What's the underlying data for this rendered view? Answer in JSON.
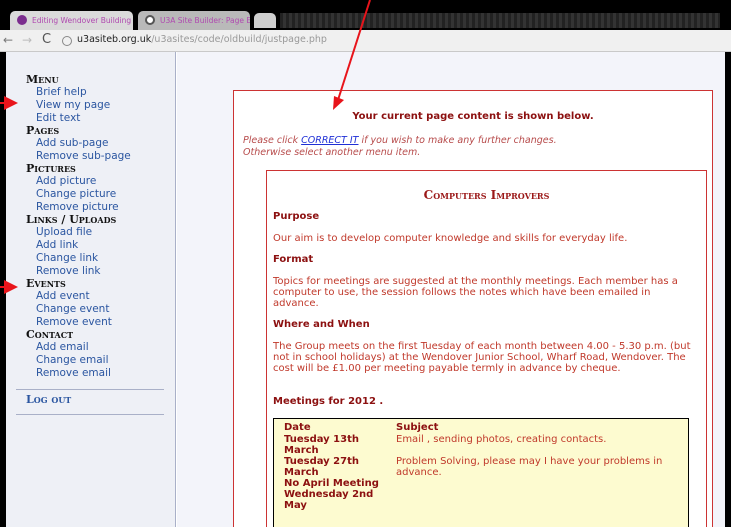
{
  "browser": {
    "tabs": [
      {
        "label": "Editing Wendover Building"
      },
      {
        "label": "U3A Site Builder: Page Edit"
      }
    ],
    "url_host": "u3asiteb.org.uk",
    "url_path": "/u3asites/code/oldbuild/justpage.php"
  },
  "sidebar": {
    "sections": [
      {
        "heading": "Menu",
        "items": [
          "Brief help",
          "View my page",
          "Edit text"
        ]
      },
      {
        "heading": "Pages",
        "items": [
          "Add sub-page",
          "Remove sub-page"
        ]
      },
      {
        "heading": "Pictures",
        "items": [
          "Add picture",
          "Change picture",
          "Remove picture"
        ]
      },
      {
        "heading": "Links / Uploads",
        "items": [
          "Upload file",
          "Add link",
          "Change link",
          "Remove link"
        ]
      },
      {
        "heading": "Events",
        "items": [
          "Add event",
          "Change event",
          "Remove event"
        ]
      },
      {
        "heading": "Contact",
        "items": [
          "Add email",
          "Change email",
          "Remove email"
        ]
      }
    ],
    "logout": "Log out"
  },
  "content": {
    "current_msg": "Your current page content is shown below.",
    "click_prefix": "Please click ",
    "correct_link": "CORRECT IT",
    "click_suffix": " if you wish to make any further changes.",
    "otherwise": "Otherwise select another menu item.",
    "page_title": "Computers Improvers",
    "purpose_head": "Purpose",
    "purpose_text": "Our aim is to develop computer knowledge and skills for everyday life.",
    "format_head": "Format",
    "format_text": "Topics for meetings are suggested at the monthly meetings. Each member has a computer to use, the session follows the notes which have been emailed in advance.",
    "where_head": "Where and When",
    "where_text": "The Group meets on the first Tuesday of each month between 4.00 - 5.30 p.m. (but not in school holidays) at the Wendover Junior School, Wharf Road, Wendover. The cost will be £1.00 per meeting payable termly in advance by cheque.",
    "meetings_head": "Meetings for 2012 .",
    "table_headers": {
      "date": "Date",
      "subject": "Subject"
    },
    "meetings": [
      {
        "date": "Tuesday 13th March",
        "subject": "Email , sending photos, creating contacts."
      },
      {
        "date": "Tuesday 27th March",
        "subject": "Problem Solving, please may I have your problems in advance."
      },
      {
        "date": "No April Meeting",
        "subject": ""
      },
      {
        "date": "Wednesday 2nd May",
        "subject": ""
      }
    ]
  },
  "colors": {
    "annotation_arrow": "#e8141b",
    "link": "#2a55a0",
    "content_text": "#c0392b"
  }
}
